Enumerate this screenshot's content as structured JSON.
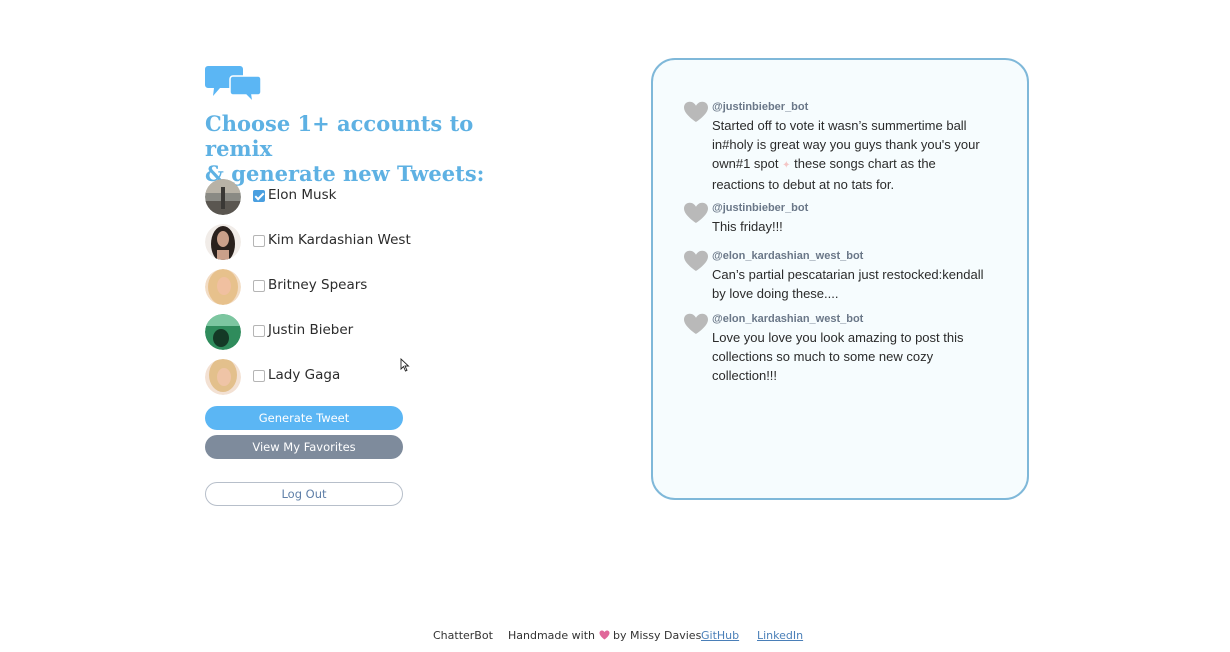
{
  "header": {
    "logo_icon": "chat-bubbles-icon",
    "heading_line1": "Choose 1+ accounts to remix",
    "heading_line2": "& generate new Tweets:"
  },
  "accounts": [
    {
      "name": "Elon Musk",
      "checked": true
    },
    {
      "name": "Kim Kardashian West",
      "checked": false
    },
    {
      "name": "Britney Spears",
      "checked": false
    },
    {
      "name": "Justin Bieber",
      "checked": false
    },
    {
      "name": "Lady Gaga",
      "checked": false
    }
  ],
  "buttons": {
    "generate": "Generate Tweet",
    "favorites": "View My Favorites",
    "logout": "Log Out"
  },
  "tweets": [
    {
      "handle": "@justinbieber_bot",
      "text_a": "Started off to vote it wasn’s summertime ball in#holy is great way you guys thank you's your own#1 spot",
      "sparkle": "✦",
      "text_b": "these songs chart as the reactions to debut at no tats for."
    },
    {
      "handle": "@justinbieber_bot",
      "text": "This friday!!!"
    },
    {
      "handle": "@elon_kardashian_west_bot",
      "text": "Can’s partial pescatarian just restocked:kendall by love doing these...."
    },
    {
      "handle": "@elon_kardashian_west_bot",
      "text": "Love you love you look amazing to post this collections so much to some new cozy collection!!!"
    }
  ],
  "footer": {
    "brand": "ChatterBot",
    "handmade_prefix": "Handmade with",
    "handmade_icon": "heart-icon",
    "handmade_suffix": "by Missy Davies",
    "github": "GitHub",
    "linkedin": "LinkedIn"
  },
  "colors": {
    "accent": "#5eb1e3",
    "button_primary": "#5bb6f4",
    "button_secondary": "#7e8b9c",
    "panel_border": "#7fb8d9",
    "heart_gray": "#b9b9b9"
  }
}
